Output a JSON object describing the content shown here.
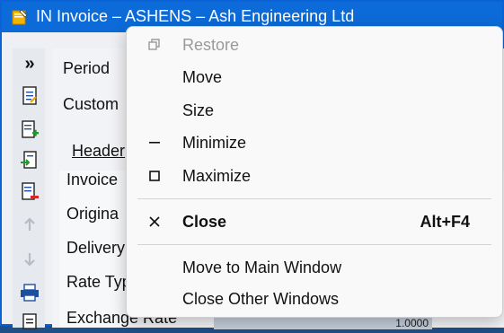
{
  "window": {
    "title": "IN Invoice – ASHENS – Ash Engineering Ltd",
    "accent": "#0c6bd8"
  },
  "toolbar": {
    "expand_glyph": "»",
    "buttons": [
      "expand-icon",
      "document-icon",
      "new-document-icon",
      "import-document-icon",
      "delete-document-icon",
      "move-up-icon",
      "move-down-icon",
      "print-icon",
      "list-icon"
    ]
  },
  "form": {
    "period_label": "Period",
    "customer_label": "Custom",
    "header_tab": "Header",
    "invoice_label": "Invoice",
    "original_label": "Origina",
    "delivery_label": "Delivery",
    "rate_type_label": "Rate Typ",
    "exchange_rate_label": "Exchange Rate",
    "exchange_rate_value": "1.0000"
  },
  "context_menu": {
    "items": [
      {
        "label": "Restore",
        "icon": "restore-icon",
        "enabled": false
      },
      {
        "label": "Move",
        "enabled": true
      },
      {
        "label": "Size",
        "enabled": true
      },
      {
        "label": "Minimize",
        "icon": "minimize-icon",
        "enabled": true
      },
      {
        "label": "Maximize",
        "icon": "maximize-icon",
        "enabled": true
      },
      {
        "label": "Close",
        "icon": "close-icon",
        "accelerator": "Alt+F4",
        "enabled": true,
        "bold": true
      },
      {
        "label": "Move to Main Window",
        "enabled": true
      },
      {
        "label": "Close Other Windows",
        "enabled": true
      }
    ]
  }
}
